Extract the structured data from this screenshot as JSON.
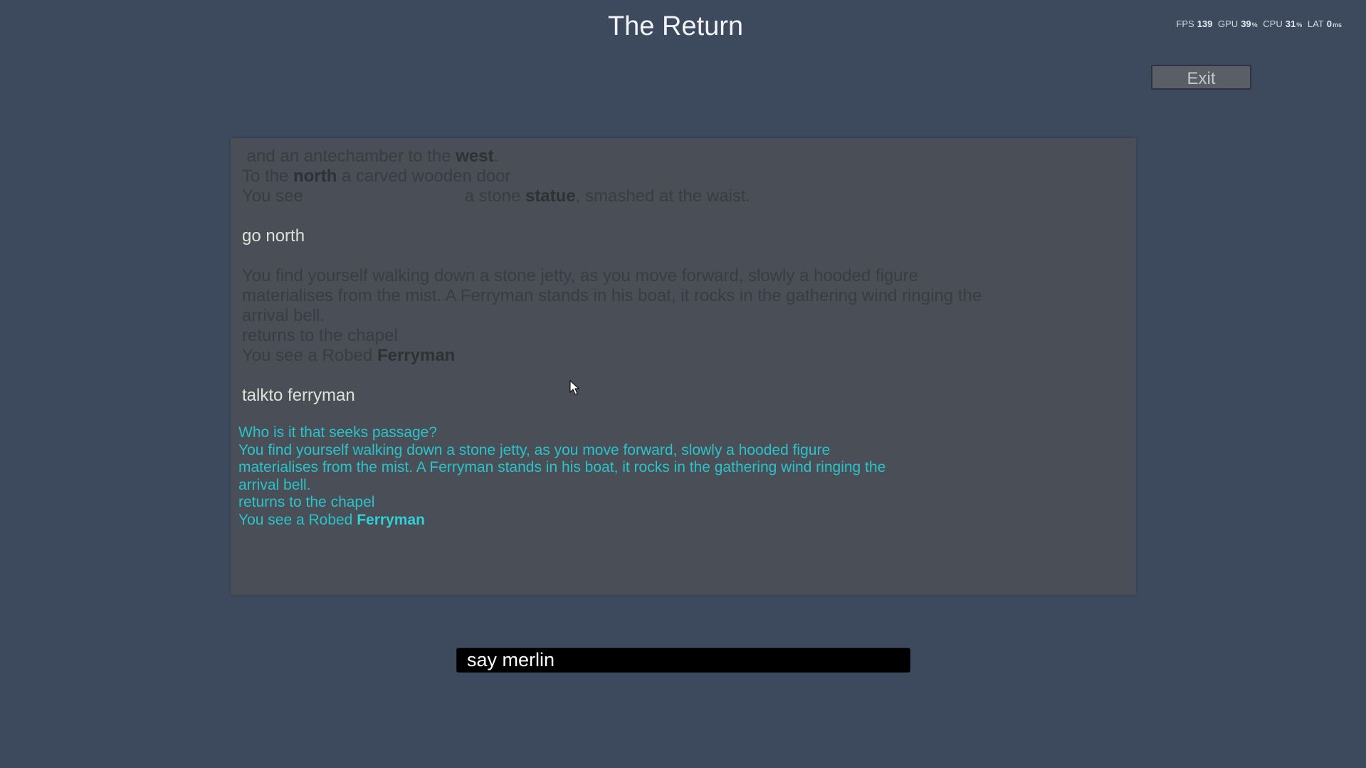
{
  "title": "The Return",
  "stats": {
    "fps_label": "FPS",
    "fps": "139",
    "gpu_label": "GPU",
    "gpu": "39",
    "cpu_label": "CPU",
    "cpu": "31",
    "percent": "%",
    "lat_label": "LAT",
    "lat": "0",
    "lat_unit": "ms"
  },
  "exit_label": "Exit",
  "log": {
    "l1_a": " and an antechamber to the ",
    "l1_b": "west",
    "l1_c": ".",
    "l2_a": "To the ",
    "l2_b": "north",
    "l2_c": " a carved wooden door",
    "l3_a": "You see                                  a stone ",
    "l3_b": "statue",
    "l3_c": ", smashed at the waist.",
    "cmd1": "go north",
    "l4": "You find yourself walking down a stone jetty, as you move forward, slowly a hooded figure",
    "l5": "materialises from the mist. A Ferryman stands in his boat, it rocks in the gathering wind ringing the",
    "l6": "arrival bell.",
    "l7": "returns to the chapel",
    "l8_a": "You see a Robed ",
    "l8_b": "Ferryman",
    "cmd2": "talkto ferryman",
    "r1": "Who is it that seeks passage?",
    "r2": "You find yourself walking down a stone jetty, as you move forward, slowly a hooded figure",
    "r3": "materialises from the mist. A Ferryman stands in his boat, it rocks in the gathering wind ringing the",
    "r4": "arrival bell.",
    "r5": "returns to the chapel",
    "r6_a": "You see a Robed ",
    "r6_b": "Ferryman"
  },
  "input": {
    "value": "say merlin"
  },
  "cursor_icon": "mouse-pointer-icon"
}
